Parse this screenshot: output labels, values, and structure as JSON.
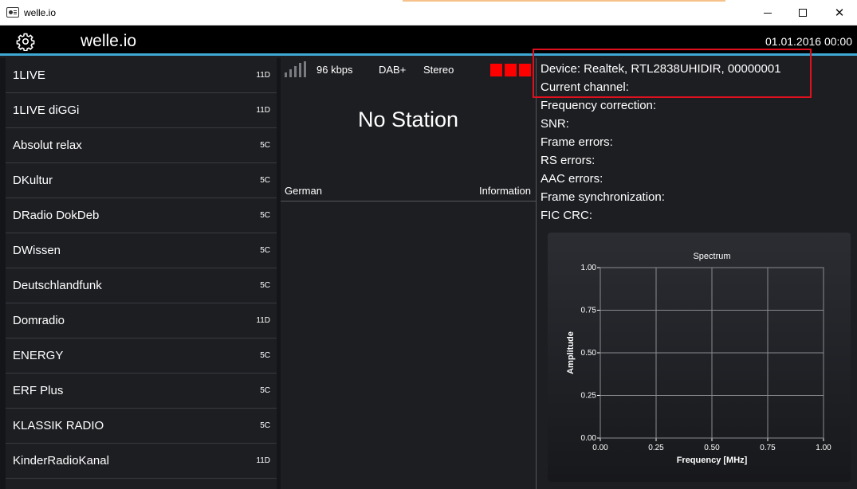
{
  "window": {
    "title": "welle.io",
    "icon": "radio-icon",
    "controls": {
      "minimize": "minimize-icon",
      "maximize": "maximize-icon",
      "close": "✕"
    }
  },
  "header": {
    "settings_icon": "gear-icon",
    "app_name": "welle.io",
    "datetime": "01.01.2016 00:00",
    "accent_color": "#3fa9d6"
  },
  "stations": [
    {
      "name": "1LIVE",
      "channel": "11D"
    },
    {
      "name": "1LIVE diGGi",
      "channel": "11D"
    },
    {
      "name": "Absolut relax",
      "channel": "5C"
    },
    {
      "name": "DKultur",
      "channel": "5C"
    },
    {
      "name": "DRadio DokDeb",
      "channel": "5C"
    },
    {
      "name": "DWissen",
      "channel": "5C"
    },
    {
      "name": "Deutschlandfunk",
      "channel": "5C"
    },
    {
      "name": "Domradio",
      "channel": "11D"
    },
    {
      "name": "ENERGY",
      "channel": "5C"
    },
    {
      "name": "ERF Plus",
      "channel": "5C"
    },
    {
      "name": "KLASSIK RADIO",
      "channel": "5C"
    },
    {
      "name": "KinderRadioKanal",
      "channel": "11D"
    }
  ],
  "player": {
    "signal_icon": "signal-strength-icon",
    "bitrate": "96 kbps",
    "codec": "DAB+",
    "mode": "Stereo",
    "indicator_color": "#ff0000",
    "station_name": "No Station",
    "language": "German",
    "info_label": "Information"
  },
  "device_info": {
    "lines": [
      "Device: Realtek, RTL2838UHIDIR, 00000001",
      "Current channel:",
      "Frequency correction:",
      "SNR:",
      "Frame errors:",
      "RS errors:",
      "AAC errors:",
      "Frame synchronization:",
      "FIC CRC:"
    ],
    "highlight_color": "#e0101e"
  },
  "chart_data": {
    "type": "line",
    "title": "Spectrum",
    "xlabel": "Frequency [MHz]",
    "ylabel": "Amplitude",
    "xlim": [
      0,
      1
    ],
    "ylim": [
      0,
      1
    ],
    "xticks": [
      "0.00",
      "0.25",
      "0.50",
      "0.75",
      "1.00"
    ],
    "yticks": [
      "0.00",
      "0.25",
      "0.50",
      "0.75",
      "1.00"
    ],
    "grid": true,
    "series": []
  }
}
